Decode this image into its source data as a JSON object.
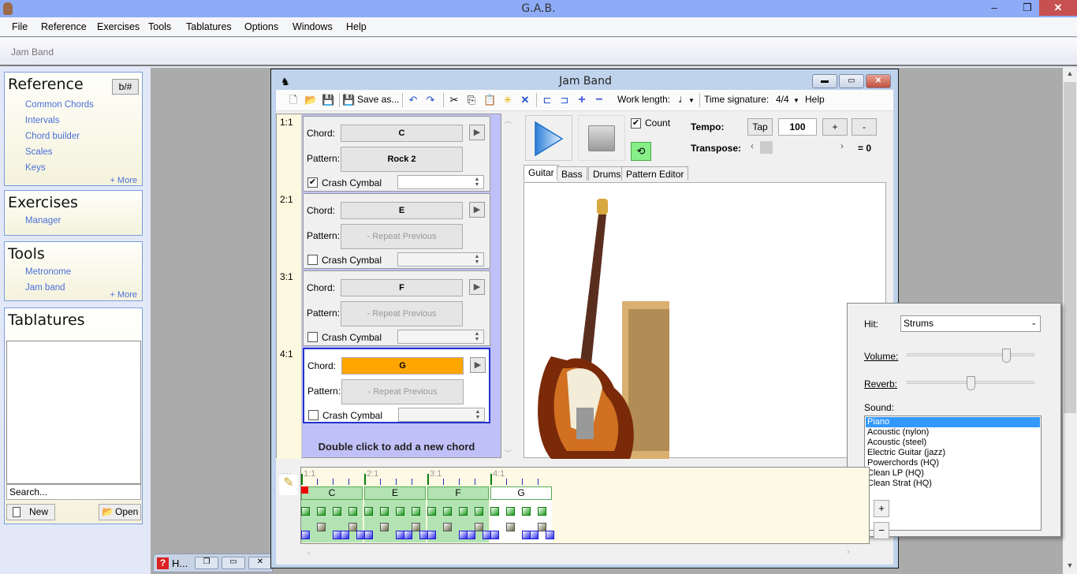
{
  "app": {
    "title": "G.A.B.",
    "breadcrumb": "Jam Band"
  },
  "window_controls": {
    "minimize": "–",
    "restore": "❐",
    "close": "✕"
  },
  "menu": [
    "File",
    "Reference",
    "Exercises",
    "Tools",
    "Tablatures",
    "Options",
    "Windows",
    "Help"
  ],
  "sidebar": {
    "reference": {
      "title": "Reference",
      "accidental_button": "b/#",
      "items": [
        "Common Chords",
        "Intervals",
        "Chord builder",
        "Scales",
        "Keys"
      ],
      "more": "+ More"
    },
    "exercises": {
      "title": "Exercises",
      "items": [
        "Manager"
      ]
    },
    "tools": {
      "title": "Tools",
      "items": [
        "Metronome",
        "Jam band"
      ],
      "more": "+ More"
    },
    "tablatures": {
      "title": "Tablatures",
      "search_placeholder": "Search...",
      "new_label": "New",
      "open_label": "Open"
    }
  },
  "minimized_window": {
    "title": "H..."
  },
  "jam_band": {
    "title": "Jam Band",
    "toolbar": {
      "save_as": "Save as...",
      "work_length_label": "Work length:",
      "work_length_value": "♩",
      "time_signature_label": "Time signature:",
      "time_signature_value": "4/4",
      "help": "Help"
    },
    "chords": [
      {
        "beat": "1:1",
        "chord": "C",
        "pattern": "Rock 2",
        "pattern_disabled": false,
        "crash_cymbal": true,
        "selected": false
      },
      {
        "beat": "2:1",
        "chord": "E",
        "pattern": "- Repeat Previous",
        "pattern_disabled": true,
        "crash_cymbal": false,
        "selected": false
      },
      {
        "beat": "3:1",
        "chord": "F",
        "pattern": "- Repeat Previous",
        "pattern_disabled": true,
        "crash_cymbal": false,
        "selected": false
      },
      {
        "beat": "4:1",
        "chord": "G",
        "pattern": "- Repeat Previous",
        "pattern_disabled": true,
        "crash_cymbal": false,
        "selected": true
      }
    ],
    "labels": {
      "chord": "Chord:",
      "pattern": "Pattern:",
      "crash_cymbal": "Crash Cymbal",
      "add_chord": "Double click to add a new chord"
    },
    "selected_chord_color": "#ffa500",
    "transport": {
      "count_label": "Count",
      "count_checked": true,
      "tempo_label": "Tempo:",
      "tap_label": "Tap",
      "tempo_value": "100",
      "plus": "+",
      "minus": "-",
      "transpose_label": "Transpose:",
      "transpose_value": "= 0"
    },
    "tabs": [
      "Guitar",
      "Bass",
      "Drums",
      "Pattern Editor"
    ],
    "active_tab": "Guitar",
    "guitar_settings": {
      "hit_label": "Hit:",
      "hit_value": "Strums",
      "volume_label": "Volume:",
      "volume_level": 0.78,
      "reverb_label": "Reverb:",
      "reverb_level": 0.5,
      "sound_label": "Sound:",
      "sounds": [
        "Piano",
        "Acoustic (nylon)",
        "Acoustic (steel)",
        "Electric Guitar (jazz)",
        "Powerchords (HQ)",
        "Clean LP (HQ)",
        "Clean Strat (HQ)"
      ],
      "selected_sound": "Piano"
    },
    "timeline": {
      "bars": [
        "1:1",
        "2:1",
        "3:1",
        "4:1"
      ],
      "blocks": [
        "C",
        "E",
        "F",
        "G"
      ],
      "zoom_in": "+",
      "zoom_out": "−"
    }
  }
}
